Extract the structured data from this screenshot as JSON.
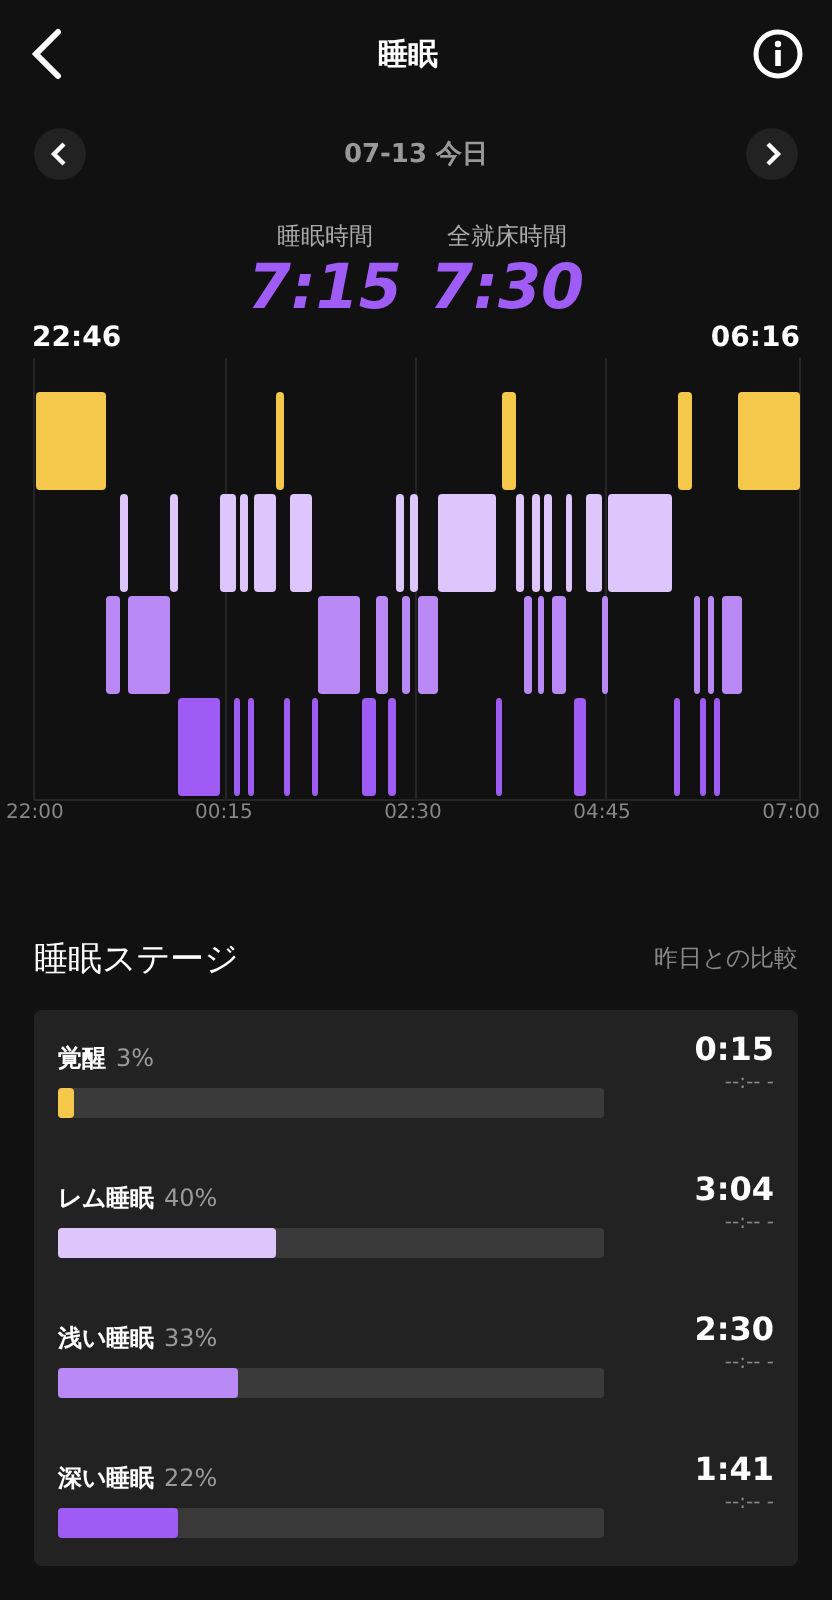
{
  "header": {
    "title": "睡眠"
  },
  "date_nav": {
    "label": "07-13 今日"
  },
  "summary": [
    {
      "label": "睡眠時間",
      "value": "7:15"
    },
    {
      "label": "全就床時間",
      "value": "7:30"
    }
  ],
  "chart": {
    "start": "22:46",
    "end": "06:16",
    "axis_labels": [
      "22:00",
      "00:15",
      "02:30",
      "04:45",
      "07:00"
    ]
  },
  "stages": {
    "title": "睡眠ステージ",
    "compare_link": "昨日との比較",
    "items": [
      {
        "name": "覚醒",
        "percent": "3%",
        "level": 0.03,
        "color": "#f5c84c",
        "duration": "0:15",
        "comparison": "--:-- -"
      },
      {
        "name": "レム睡眠",
        "percent": "40%",
        "level": 0.4,
        "color": "#dcc6fb",
        "duration": "3:04",
        "comparison": "--:-- -"
      },
      {
        "name": "浅い睡眠",
        "percent": "33%",
        "level": 0.33,
        "color": "#b98af6",
        "duration": "2:30",
        "comparison": "--:-- -"
      },
      {
        "name": "深い睡眠",
        "percent": "22%",
        "level": 0.22,
        "color": "#9f5cf5",
        "duration": "1:41",
        "comparison": "--:-- -"
      }
    ]
  }
}
